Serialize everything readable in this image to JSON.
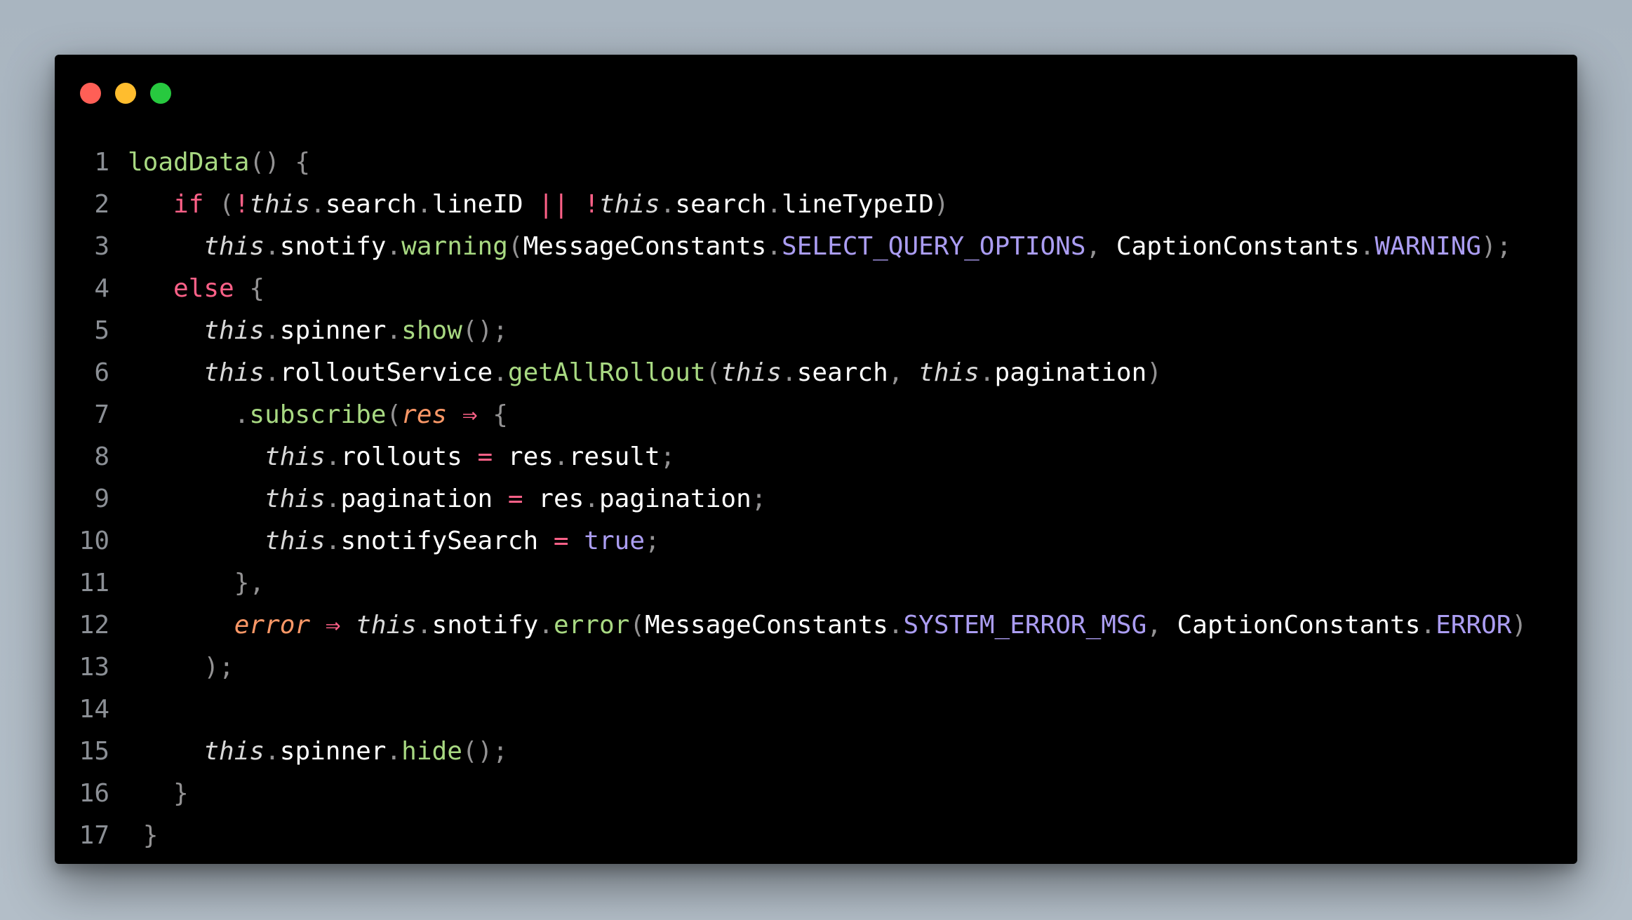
{
  "window": {
    "controls": [
      "close",
      "minimize",
      "maximize"
    ]
  },
  "lines": [
    {
      "n": "1",
      "indent": "",
      "tokens": [
        [
          "loadData",
          "func"
        ],
        [
          "() {",
          "punc"
        ]
      ]
    },
    {
      "n": "2",
      "indent": "   ",
      "tokens": [
        [
          "if",
          "kw"
        ],
        [
          " (",
          "punc"
        ],
        [
          "!",
          "op"
        ],
        [
          "this",
          "this"
        ],
        [
          ".",
          "punc"
        ],
        [
          "search",
          "prop"
        ],
        [
          ".",
          "punc"
        ],
        [
          "lineID",
          "prop"
        ],
        [
          " ",
          "punc"
        ],
        [
          "||",
          "op"
        ],
        [
          " ",
          "punc"
        ],
        [
          "!",
          "op"
        ],
        [
          "this",
          "this"
        ],
        [
          ".",
          "punc"
        ],
        [
          "search",
          "prop"
        ],
        [
          ".",
          "punc"
        ],
        [
          "lineTypeID",
          "prop"
        ],
        [
          ")",
          "punc"
        ]
      ]
    },
    {
      "n": "3",
      "indent": "     ",
      "tokens": [
        [
          "this",
          "this"
        ],
        [
          ".",
          "punc"
        ],
        [
          "snotify",
          "prop"
        ],
        [
          ".",
          "punc"
        ],
        [
          "warning",
          "func"
        ],
        [
          "(",
          "punc"
        ],
        [
          "MessageConstants",
          "prop"
        ],
        [
          ".",
          "punc"
        ],
        [
          "SELECT_QUERY_OPTIONS",
          "const"
        ],
        [
          ", ",
          "punc"
        ],
        [
          "CaptionConstants",
          "prop"
        ],
        [
          ".",
          "punc"
        ],
        [
          "WARNING",
          "const"
        ],
        [
          ");",
          "punc"
        ]
      ]
    },
    {
      "n": "4",
      "indent": "   ",
      "tokens": [
        [
          "else",
          "kw"
        ],
        [
          " {",
          "punc"
        ]
      ]
    },
    {
      "n": "5",
      "indent": "     ",
      "tokens": [
        [
          "this",
          "this"
        ],
        [
          ".",
          "punc"
        ],
        [
          "spinner",
          "prop"
        ],
        [
          ".",
          "punc"
        ],
        [
          "show",
          "func"
        ],
        [
          "();",
          "punc"
        ]
      ]
    },
    {
      "n": "6",
      "indent": "     ",
      "tokens": [
        [
          "this",
          "this"
        ],
        [
          ".",
          "punc"
        ],
        [
          "rolloutService",
          "prop"
        ],
        [
          ".",
          "punc"
        ],
        [
          "getAllRollout",
          "func"
        ],
        [
          "(",
          "punc"
        ],
        [
          "this",
          "this"
        ],
        [
          ".",
          "punc"
        ],
        [
          "search",
          "prop"
        ],
        [
          ", ",
          "punc"
        ],
        [
          "this",
          "this"
        ],
        [
          ".",
          "punc"
        ],
        [
          "pagination",
          "prop"
        ],
        [
          ")",
          "punc"
        ]
      ]
    },
    {
      "n": "7",
      "indent": "       ",
      "tokens": [
        [
          ".",
          "punc"
        ],
        [
          "subscribe",
          "func"
        ],
        [
          "(",
          "punc"
        ],
        [
          "res",
          "param"
        ],
        [
          " ",
          "punc"
        ],
        [
          "⇒",
          "op"
        ],
        [
          " {",
          "punc"
        ]
      ]
    },
    {
      "n": "8",
      "indent": "         ",
      "tokens": [
        [
          "this",
          "this"
        ],
        [
          ".",
          "punc"
        ],
        [
          "rollouts",
          "prop"
        ],
        [
          " ",
          "punc"
        ],
        [
          "=",
          "op"
        ],
        [
          " ",
          "punc"
        ],
        [
          "res",
          "prop"
        ],
        [
          ".",
          "punc"
        ],
        [
          "result",
          "prop"
        ],
        [
          ";",
          "punc"
        ]
      ]
    },
    {
      "n": "9",
      "indent": "         ",
      "tokens": [
        [
          "this",
          "this"
        ],
        [
          ".",
          "punc"
        ],
        [
          "pagination",
          "prop"
        ],
        [
          " ",
          "punc"
        ],
        [
          "=",
          "op"
        ],
        [
          " ",
          "punc"
        ],
        [
          "res",
          "prop"
        ],
        [
          ".",
          "punc"
        ],
        [
          "pagination",
          "prop"
        ],
        [
          ";",
          "punc"
        ]
      ]
    },
    {
      "n": "10",
      "indent": "         ",
      "tokens": [
        [
          "this",
          "this"
        ],
        [
          ".",
          "punc"
        ],
        [
          "snotifySearch",
          "prop"
        ],
        [
          " ",
          "punc"
        ],
        [
          "=",
          "op"
        ],
        [
          " ",
          "punc"
        ],
        [
          "true",
          "const"
        ],
        [
          ";",
          "punc"
        ]
      ]
    },
    {
      "n": "11",
      "indent": "       ",
      "tokens": [
        [
          "},",
          "punc"
        ]
      ]
    },
    {
      "n": "12",
      "indent": "       ",
      "tokens": [
        [
          "error",
          "param"
        ],
        [
          " ",
          "punc"
        ],
        [
          "⇒",
          "op"
        ],
        [
          " ",
          "punc"
        ],
        [
          "this",
          "this"
        ],
        [
          ".",
          "punc"
        ],
        [
          "snotify",
          "prop"
        ],
        [
          ".",
          "punc"
        ],
        [
          "error",
          "func"
        ],
        [
          "(",
          "punc"
        ],
        [
          "MessageConstants",
          "prop"
        ],
        [
          ".",
          "punc"
        ],
        [
          "SYSTEM_ERROR_MSG",
          "const"
        ],
        [
          ", ",
          "punc"
        ],
        [
          "CaptionConstants",
          "prop"
        ],
        [
          ".",
          "punc"
        ],
        [
          "ERROR",
          "const"
        ],
        [
          ")",
          "punc"
        ]
      ]
    },
    {
      "n": "13",
      "indent": "     ",
      "tokens": [
        [
          ");",
          "punc"
        ]
      ]
    },
    {
      "n": "14",
      "indent": "",
      "tokens": []
    },
    {
      "n": "15",
      "indent": "     ",
      "tokens": [
        [
          "this",
          "this"
        ],
        [
          ".",
          "punc"
        ],
        [
          "spinner",
          "prop"
        ],
        [
          ".",
          "punc"
        ],
        [
          "hide",
          "func"
        ],
        [
          "();",
          "punc"
        ]
      ]
    },
    {
      "n": "16",
      "indent": "   ",
      "tokens": [
        [
          "}",
          "punc"
        ]
      ]
    },
    {
      "n": "17",
      "indent": " ",
      "tokens": [
        [
          "}",
          "punc"
        ]
      ]
    }
  ]
}
